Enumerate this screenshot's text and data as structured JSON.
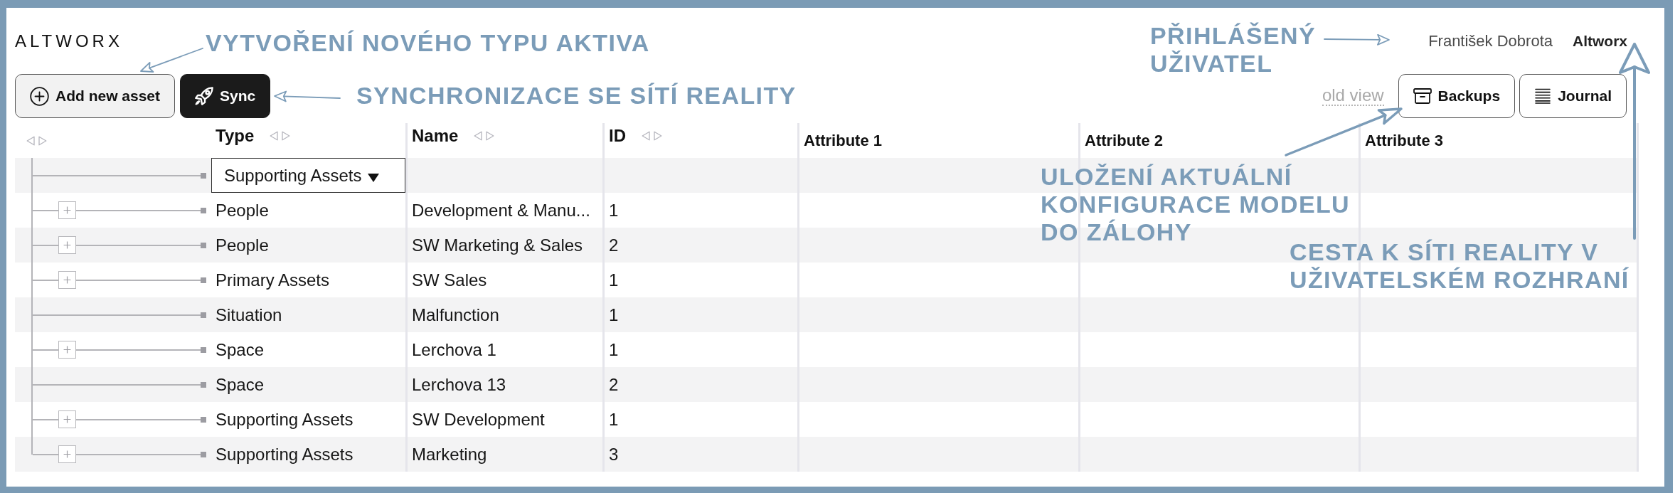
{
  "logo": "ALTWORX",
  "user": {
    "name": "František Dobrota",
    "organization": "Altworx"
  },
  "actions": [
    {
      "kind": "add",
      "label": "Add new asset",
      "primary": false
    },
    {
      "kind": "sync",
      "label": "Sync",
      "primary": true
    }
  ],
  "old_view_link": "old view",
  "tools": [
    {
      "kind": "backups",
      "label": "Backups"
    },
    {
      "kind": "journal",
      "label": "Journal"
    }
  ],
  "table": {
    "columns": [
      {
        "sortable": true
      },
      {
        "label": "Type",
        "sortable": true
      },
      {
        "label": "Name",
        "sortable": true
      },
      {
        "label": "ID",
        "sortable": true
      },
      {
        "label": "Attribute 1",
        "sortable": false
      },
      {
        "label": "Attribute 2",
        "sortable": false
      },
      {
        "label": "Attribute 3",
        "sortable": false
      }
    ],
    "rows": [
      {
        "kind": "editor",
        "type": "Supporting Assets",
        "expandable": false
      },
      {
        "kind": "asset",
        "type": "People",
        "name": "Development & Manu...",
        "id": "1",
        "expandable": true
      },
      {
        "kind": "asset",
        "type": "People",
        "name": "SW Marketing & Sales",
        "id": "2",
        "expandable": true
      },
      {
        "kind": "asset",
        "type": "Primary Assets",
        "name": "SW Sales",
        "id": "1",
        "expandable": true
      },
      {
        "kind": "asset",
        "type": "Situation",
        "name": "Malfunction",
        "id": "1",
        "expandable": false
      },
      {
        "kind": "asset",
        "type": "Space",
        "name": "Lerchova 1",
        "id": "1",
        "expandable": true
      },
      {
        "kind": "asset",
        "type": "Space",
        "name": "Lerchova 13",
        "id": "2",
        "expandable": false
      },
      {
        "kind": "asset",
        "type": "Supporting Assets",
        "name": "SW Development",
        "id": "1",
        "expandable": true
      },
      {
        "kind": "asset",
        "type": "Supporting Assets",
        "name": "Marketing",
        "id": "3",
        "expandable": true
      }
    ]
  },
  "annotations": [
    {
      "text": "VYTVOŘENÍ NOVÉHO TYPU AKTIVA"
    },
    {
      "text": "SYNCHRONIZACE SE SÍTÍ REALITY"
    },
    {
      "text": "PŘIHLÁŠENÝ\nUŽIVATEL"
    },
    {
      "text": "ULOŽENÍ AKTUÁLNÍ\nKONFIGURACE MODELU\nDO ZÁLOHY"
    },
    {
      "text": "CESTA K SÍTI REALITY V\nUŽIVATELSKÉM ROZHRANÍ"
    }
  ]
}
